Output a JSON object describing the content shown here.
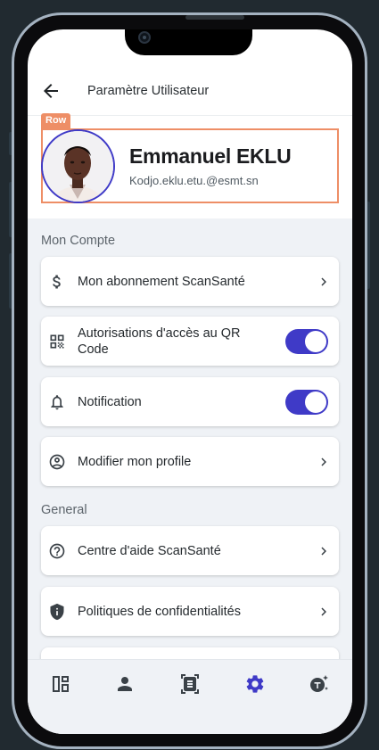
{
  "header": {
    "title": "Paramètre Utilisateur"
  },
  "debug_tag": "Row",
  "profile": {
    "name": "Emmanuel EKLU",
    "email": "Kodjo.eklu.etu.@esmt.sn"
  },
  "sections": {
    "account_title": "Mon Compte",
    "general_title": "General"
  },
  "account_items": [
    {
      "label": "Mon abonnement ScanSanté",
      "icon": "dollar-icon",
      "control": "chevron"
    },
    {
      "label": "Autorisations d'accès au QR Code",
      "icon": "qr-code-icon",
      "control": "toggle",
      "on": true
    },
    {
      "label": "Notification",
      "icon": "bell-icon",
      "control": "toggle",
      "on": true
    },
    {
      "label": "Modifier mon profile",
      "icon": "account-circle-icon",
      "control": "chevron"
    }
  ],
  "general_items": [
    {
      "label": "Centre d'aide ScanSanté",
      "icon": "help-circle-icon",
      "control": "chevron"
    },
    {
      "label": "Politiques de confidentialités",
      "icon": "shield-icon",
      "control": "chevron"
    }
  ],
  "bottom_nav": [
    {
      "name": "dashboard",
      "icon": "dashboard-icon",
      "active": false
    },
    {
      "name": "profile",
      "icon": "person-icon",
      "active": false
    },
    {
      "name": "scan",
      "icon": "document-scanner-icon",
      "active": false
    },
    {
      "name": "settings",
      "icon": "gear-icon",
      "active": true
    },
    {
      "name": "translate",
      "icon": "text-ai-icon",
      "active": false
    }
  ],
  "colors": {
    "accent": "#3f3ac7",
    "debug_outline": "#ee8e66",
    "background": "#eff2f6",
    "frame": "#a4b2c0"
  }
}
